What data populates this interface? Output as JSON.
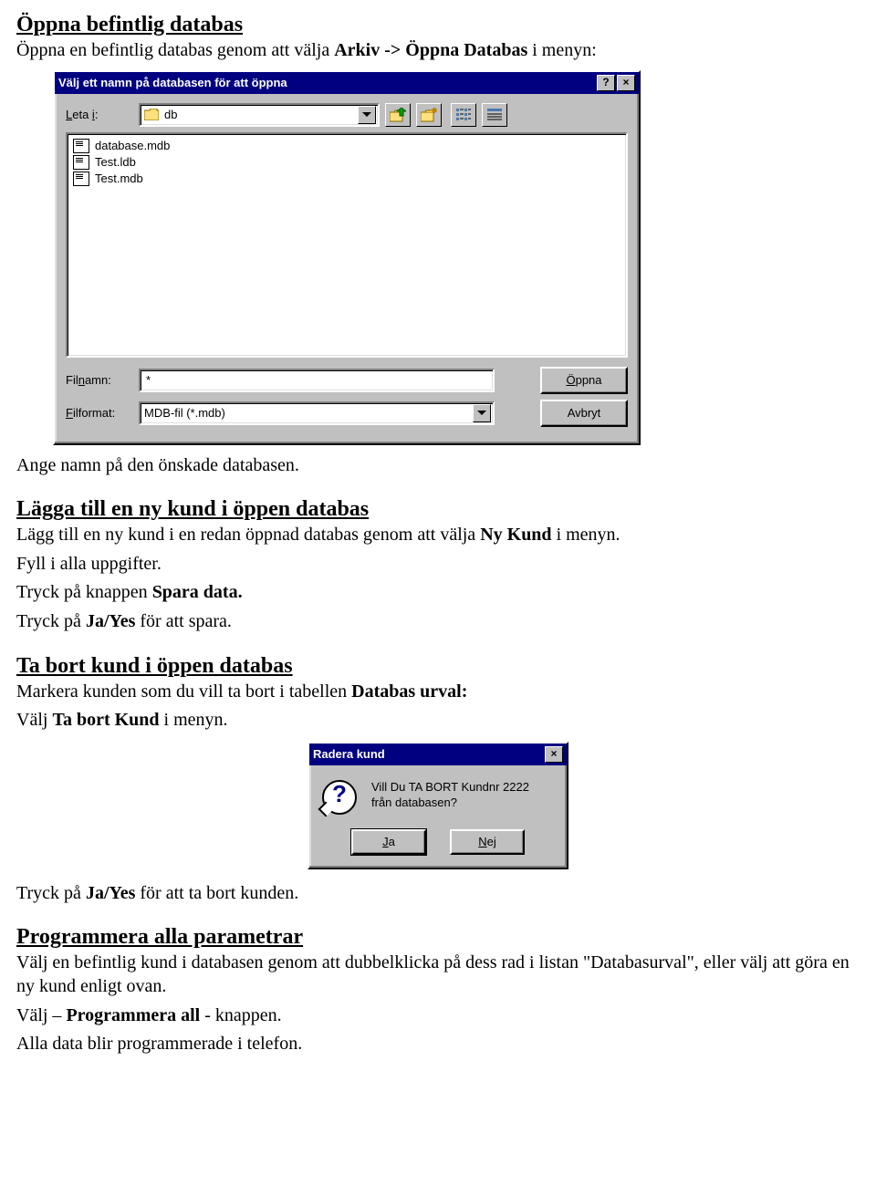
{
  "sections": {
    "openExisting": {
      "heading": "Öppna befintlig databas",
      "intro_pre": "Öppna en befintlig databas genom att välja ",
      "intro_bold": "Arkiv -> Öppna Databas",
      "intro_post": " i menyn:",
      "outro": "Ange namn på den önskade databasen."
    },
    "addCustomer": {
      "heading": "Lägga till en ny kund i öppen databas",
      "p1_pre": "Lägg till en ny kund i en redan öppnad databas genom att välja ",
      "p1_bold": "Ny Kund",
      "p1_post": " i menyn.",
      "p2": "Fyll i alla uppgifter.",
      "p3_pre": "Tryck på knappen ",
      "p3_bold": "Spara data.",
      "p4_pre": "Tryck på ",
      "p4_bold": "Ja/Yes",
      "p4_post": " för att spara."
    },
    "removeCustomer": {
      "heading": "Ta bort kund i öppen databas",
      "p1_pre": "Markera kunden som du vill ta bort i tabellen ",
      "p1_bold": "Databas urval:",
      "p2_pre": "Välj ",
      "p2_bold": "Ta bort Kund",
      "p2_post": " i menyn.",
      "after_pre": "Tryck på ",
      "after_bold": "Ja/Yes",
      "after_post": " för att ta bort kunden."
    },
    "programAll": {
      "heading": "Programmera alla parametrar",
      "p1": "Välj en befintlig kund i databasen genom att dubbelklicka på dess rad i listan \"Databasurval\", eller välj att göra en ny kund enligt ovan.",
      "p2_pre": "Välj – ",
      "p2_bold": "Programmera all",
      "p2_post": " - knappen.",
      "p3": "Alla data blir programmerade i telefon."
    }
  },
  "openDialog": {
    "title": "Välj ett namn på databasen för att öppna",
    "lookIn_label": "Leta i:",
    "lookIn_value": "db",
    "files": [
      "database.mdb",
      "Test.ldb",
      "Test.mdb"
    ],
    "filename_label": "Filnamn:",
    "filename_value": "*",
    "filetype_label": "Filformat:",
    "filetype_value": "MDB-fil (*.mdb)",
    "open_btn_prefix": "Ö",
    "open_btn_rest": "ppna",
    "cancel_btn": "Avbryt"
  },
  "msgBox": {
    "title": "Radera kund",
    "line1": "Vill Du TA BORT Kundnr 2222",
    "line2": "från databasen?",
    "yes_prefix": "J",
    "yes_rest": "a",
    "no_prefix": "N",
    "no_rest": "ej"
  }
}
